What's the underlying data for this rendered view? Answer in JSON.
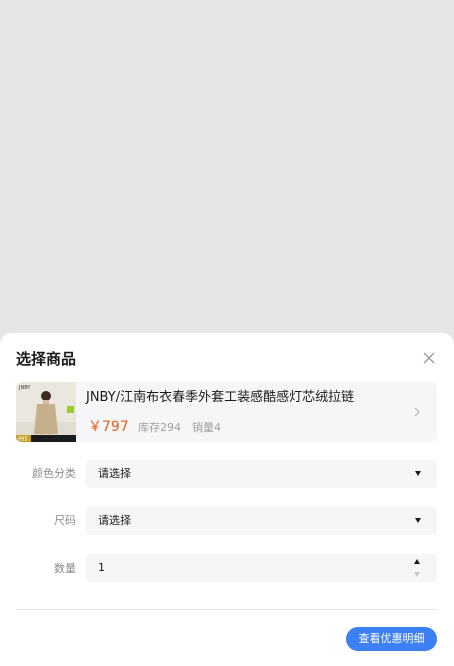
{
  "sheet": {
    "title": "选择商品",
    "close_icon": "close-icon"
  },
  "product": {
    "thumb_brand": "JNBY",
    "thumb_price_tag": "895",
    "name": "JNBY/江南布衣春季外套工装感酷感灯芯绒拉链",
    "price": "￥797",
    "stock": "库存294",
    "sales": "销量4",
    "chevron_icon": "chevron-right-icon"
  },
  "fields": {
    "color": {
      "label": "颜色分类",
      "value": "请选择"
    },
    "size": {
      "label": "尺码",
      "value": "请选择"
    },
    "quantity": {
      "label": "数量",
      "value": "1"
    }
  },
  "actions": {
    "view_discount_label": "查看优惠明细"
  },
  "colors": {
    "accent": "#3d7ff5",
    "price": "#f05a1a",
    "backdrop": "#e6e6e6",
    "field_bg": "#f5f6f7"
  }
}
